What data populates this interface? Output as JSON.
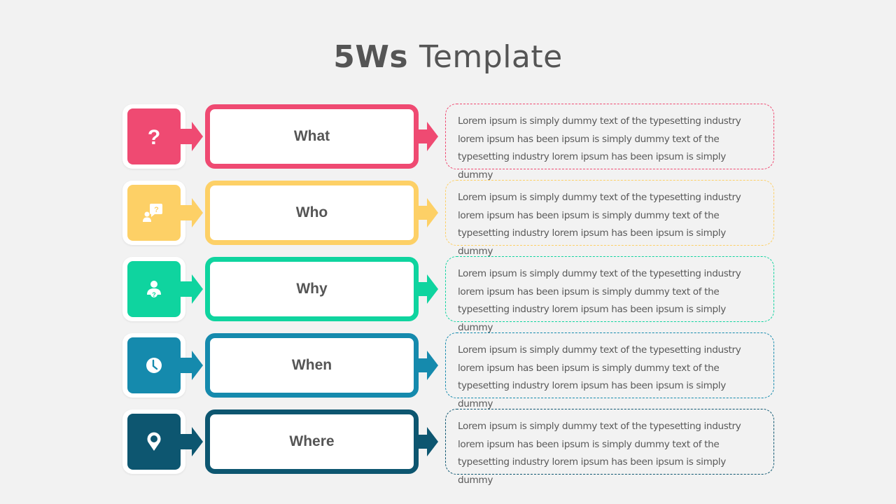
{
  "title": {
    "bold": "5Ws",
    "light": "Template"
  },
  "rows": [
    {
      "label": "What",
      "icon": "question-mark-icon",
      "color": "#ef4a72",
      "description": "Lorem ipsum is simply dummy text of the typesetting industry lorem ipsum has been ipsum is simply dummy text of the typesetting industry lorem ipsum has been ipsum is simply dummy"
    },
    {
      "label": "Who",
      "icon": "person-question-bubble-icon",
      "color": "#fdd066",
      "description": "Lorem ipsum is simply dummy text of the typesetting industry lorem ipsum has been ipsum is simply dummy text of the typesetting industry lorem ipsum has been ipsum is simply dummy"
    },
    {
      "label": "Why",
      "icon": "person-question-icon",
      "color": "#0fd49f",
      "description": "Lorem ipsum is simply dummy text of the typesetting industry lorem ipsum has been ipsum is simply dummy text of the typesetting industry lorem ipsum has been ipsum is simply dummy"
    },
    {
      "label": "When",
      "icon": "clock-icon",
      "color": "#158aad",
      "description": "Lorem ipsum is simply dummy text of the typesetting industry lorem ipsum has been ipsum is simply dummy text of the typesetting industry lorem ipsum has been ipsum is simply dummy"
    },
    {
      "label": "Where",
      "icon": "location-pin-icon",
      "color": "#0d5670",
      "description": "Lorem ipsum is simply dummy text of the typesetting industry lorem ipsum has been ipsum is simply dummy text of the typesetting industry lorem ipsum has been ipsum is simply dummy"
    }
  ]
}
